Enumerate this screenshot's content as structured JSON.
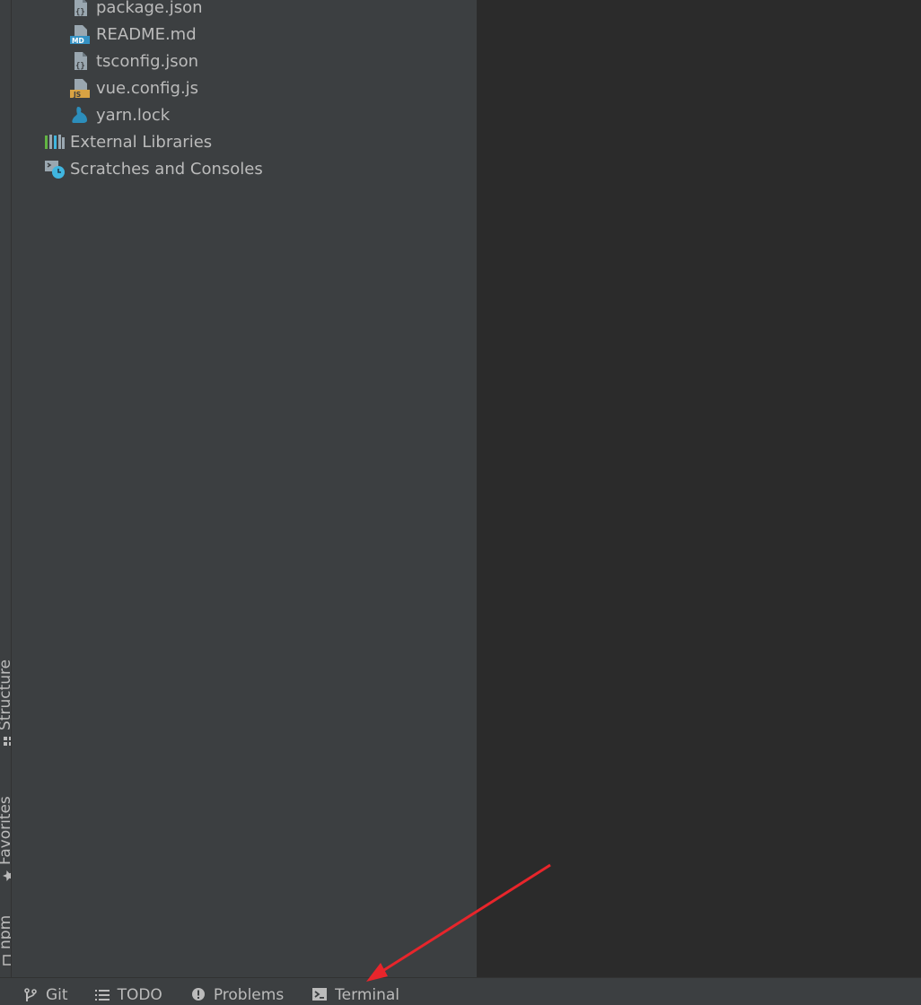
{
  "project_tree": [
    {
      "label": "package.json",
      "icon": "json-file-icon"
    },
    {
      "label": "README.md",
      "icon": "markdown-file-icon"
    },
    {
      "label": "tsconfig.json",
      "icon": "json-file-icon"
    },
    {
      "label": "vue.config.js",
      "icon": "js-file-icon"
    },
    {
      "label": "yarn.lock",
      "icon": "yarn-icon"
    },
    {
      "label": "External Libraries",
      "icon": "libraries-icon"
    },
    {
      "label": "Scratches and Consoles",
      "icon": "scratches-icon"
    }
  ],
  "left_strip": {
    "structure_label": "Structure",
    "favorites_label": "Favorites",
    "npm_label": "npm"
  },
  "bottom_tabs": [
    {
      "label": "Git",
      "icon": "git-branch-icon"
    },
    {
      "label": "TODO",
      "icon": "list-icon"
    },
    {
      "label": "Problems",
      "icon": "exclamation-icon"
    },
    {
      "label": "Terminal",
      "icon": "terminal-icon"
    }
  ],
  "colors": {
    "panel_bg": "#3c3f41",
    "editor_bg": "#2b2b2b",
    "text": "#bbbbbb",
    "annotation_arrow": "#e8252b"
  }
}
